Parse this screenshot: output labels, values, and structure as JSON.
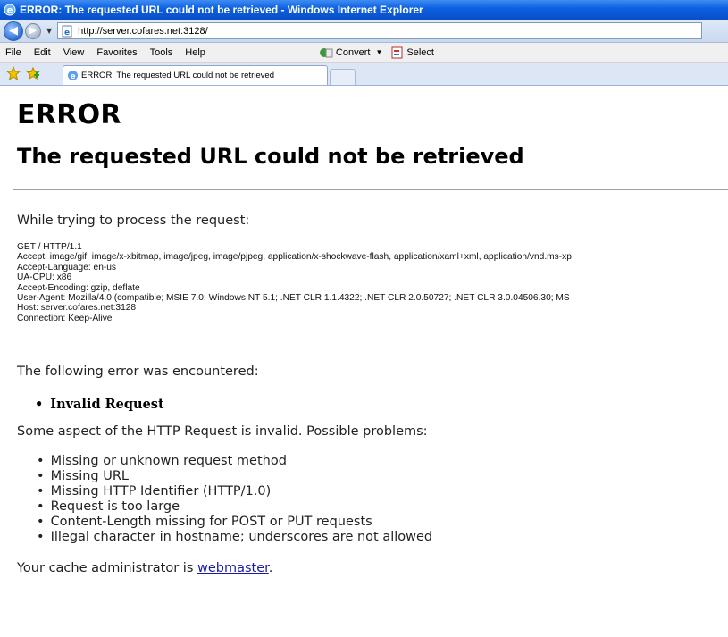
{
  "window": {
    "title": "ERROR: The requested URL could not be retrieved - Windows Internet Explorer"
  },
  "address_bar": {
    "url": "http://server.cofares.net:3128/"
  },
  "menu": {
    "items": [
      "File",
      "Edit",
      "View",
      "Favorites",
      "Tools",
      "Help"
    ],
    "convert_label": "Convert",
    "select_label": "Select"
  },
  "tab": {
    "label": "ERROR: The requested URL could not be retrieved"
  },
  "page": {
    "heading": "ERROR",
    "subheading": "The requested URL could not be retrieved",
    "while_text": "While trying to process the request:",
    "request_lines": [
      "GET / HTTP/1.1",
      "Accept: image/gif, image/x-xbitmap, image/jpeg, image/pjpeg, application/x-shockwave-flash, application/xaml+xml, application/vnd.ms-xp",
      "Accept-Language: en-us",
      "UA-CPU: x86",
      "Accept-Encoding: gzip, deflate",
      "User-Agent: Mozilla/4.0 (compatible; MSIE 7.0; Windows NT 5.1; .NET CLR 1.1.4322; .NET CLR 2.0.50727; .NET CLR 3.0.04506.30; MS",
      "Host: server.cofares.net:3128",
      "Connection: Keep-Alive"
    ],
    "following_text": "The following error was encountered:",
    "error_name": "Invalid Request",
    "aspect_text": "Some aspect of the HTTP Request is invalid. Possible problems:",
    "problems": [
      "Missing or unknown request method",
      "Missing URL",
      "Missing HTTP Identifier (HTTP/1.0)",
      "Request is too large",
      "Content-Length missing for POST or PUT requests",
      "Illegal character in hostname; underscores are not allowed"
    ],
    "admin_prefix": "Your cache administrator is ",
    "admin_link": "webmaster",
    "admin_suffix": "."
  }
}
